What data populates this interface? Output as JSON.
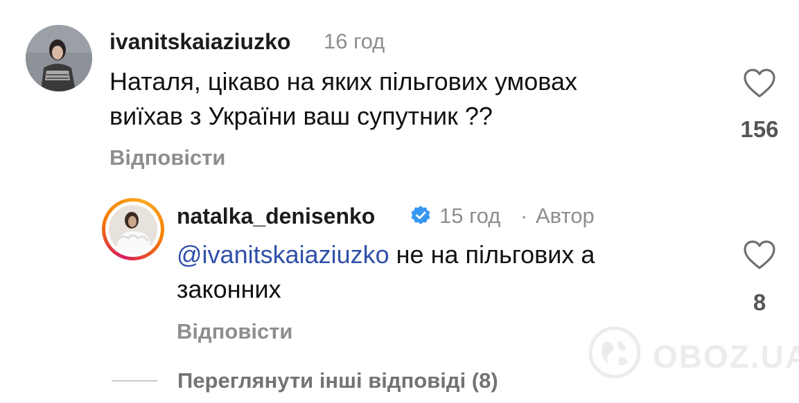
{
  "comment": {
    "username": "ivanitskaiaziuzko",
    "time": "16 год",
    "text_line1": "Наталя, цікаво на яких пільгових умовах",
    "text_line2": "виїхав з України ваш супутник ??",
    "likes": "156",
    "reply_label": "Відповісти"
  },
  "reply_comment": {
    "username": "natalka_denisenko",
    "time": "15 год",
    "separator": "·",
    "author_label": "Автор",
    "mention": "@ivanitskaiaziuzko",
    "text_rest": " не на пільгових а",
    "text_line2": "законних",
    "likes": "8",
    "reply_label": "Відповісти"
  },
  "view_more": "Переглянути інші відповіді (8)",
  "watermark": "OBOZ.UA",
  "colors": {
    "mention": "#2f4fa8",
    "verified": "#3897f0",
    "story_ring_start": "#f9a825",
    "story_ring_end": "#d81b60"
  }
}
